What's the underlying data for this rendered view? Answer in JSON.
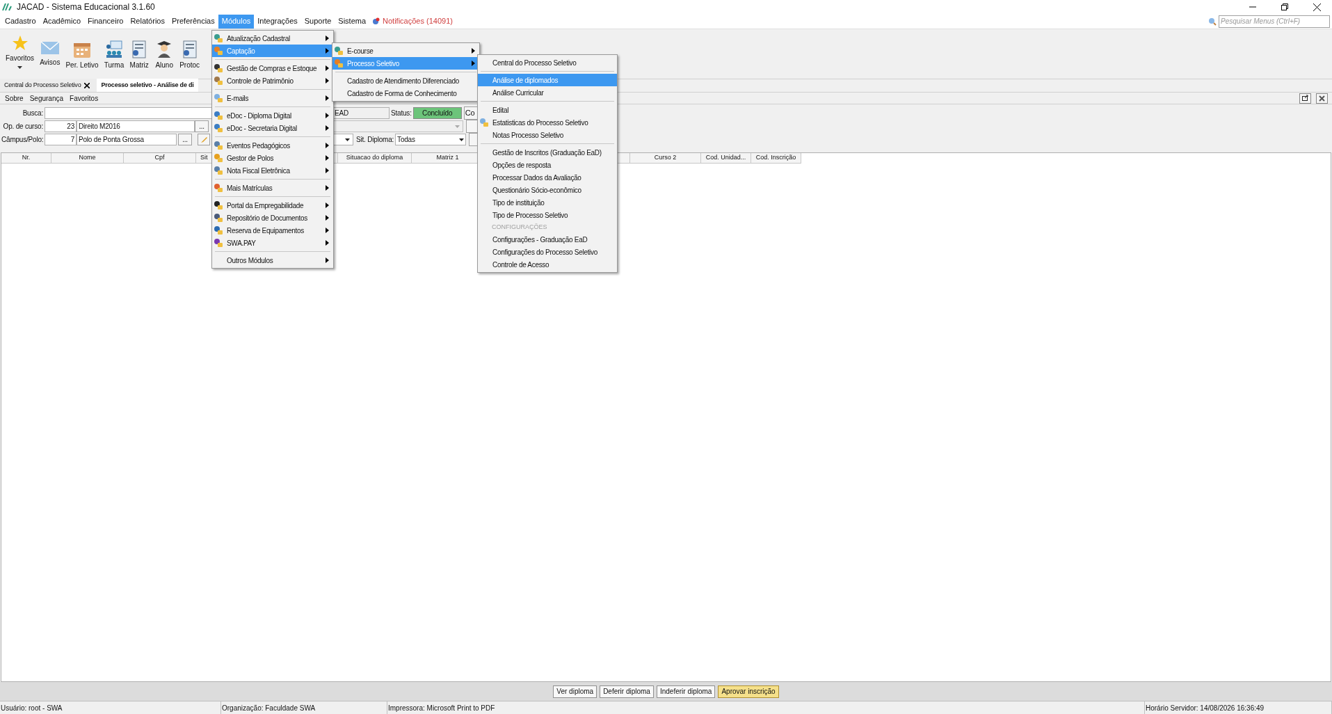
{
  "window": {
    "title": "JACAD - Sistema Educacional 3.1.60"
  },
  "menubar": [
    {
      "label": "Cadastro",
      "selected": false
    },
    {
      "label": "Acadêmico",
      "selected": false
    },
    {
      "label": "Financeiro",
      "selected": false
    },
    {
      "label": "Relatórios",
      "selected": false
    },
    {
      "label": "Preferências",
      "selected": false
    },
    {
      "label": "Módulos",
      "selected": true
    },
    {
      "label": "Integrações",
      "selected": false
    },
    {
      "label": "Suporte",
      "selected": false
    },
    {
      "label": "Sistema",
      "selected": false
    }
  ],
  "notifications": "Notificações (14091)",
  "menu_search": {
    "placeholder": "Pesquisar Menus (Ctrl+F)"
  },
  "toolbar": [
    {
      "label": "Favoritos",
      "kind": "star"
    },
    {
      "label": "Avisos",
      "kind": "mail"
    },
    {
      "label": "Per. Letivo",
      "kind": "calendar"
    },
    {
      "label": "Turma",
      "kind": "class"
    },
    {
      "label": "Matriz",
      "kind": "doc"
    },
    {
      "label": "Aluno",
      "kind": "student"
    },
    {
      "label": "Protoc",
      "kind": "doc"
    }
  ],
  "tabs": [
    {
      "label": "Central do Processo Seletivo",
      "selected": false,
      "closable": true
    },
    {
      "label": "Processo seletivo - Análise de di",
      "selected": true,
      "closable": false
    }
  ],
  "submenu": [
    "Sobre",
    "Segurança",
    "Favoritos"
  ],
  "form": {
    "busca_label": "Busca:",
    "course_label": "Op. de curso:",
    "course_code": "23",
    "course_name": "Direito M2016",
    "campus_label": "Câmpus/Polo:",
    "campus_code": "7",
    "campus_name": "Polo de Ponta Grossa",
    "ellipsis_1": "...",
    "ellipsis_2": "...",
    "ead_value": "EAD",
    "status_label": "Status:",
    "status_value": "Concluído",
    "co_button": "Co",
    "diploma_label": "Sit. Diploma:",
    "diploma_value": "Todas"
  },
  "table": {
    "columns": [
      "Nr.",
      "Nome",
      "Cpf",
      "Sit",
      "",
      "Situacao do diploma",
      "Matriz 1",
      "",
      "Curso 2",
      "Cod. Unidad...",
      "Cod. Inscrição"
    ]
  },
  "actions": [
    {
      "label": "Ver diploma",
      "highlighted": false
    },
    {
      "label": "Deferir diploma",
      "highlighted": false
    },
    {
      "label": "Indeferir diploma",
      "highlighted": false
    },
    {
      "label": "Aprovar inscrição",
      "highlighted": true
    }
  ],
  "status_bar": [
    "Usuário: root - SWA",
    "Organização: Faculdade SWA",
    "Impressora: Microsoft Print to PDF",
    "Horário Servidor: 14/08/2026 16:36:49"
  ],
  "modules_menu": [
    {
      "kind": "item",
      "label": "Atualização Cadastral",
      "has_icon": true,
      "selected": false
    },
    {
      "kind": "item",
      "label": "Captação",
      "has_icon": true,
      "selected": true
    },
    {
      "kind": "separator"
    },
    {
      "kind": "item",
      "label": "Gestão de Compras e Estoque",
      "has_icon": true,
      "selected": false
    },
    {
      "kind": "item",
      "label": "Controle de Patrimônio",
      "has_icon": true,
      "selected": false
    },
    {
      "kind": "separator"
    },
    {
      "kind": "item",
      "label": "E-mails",
      "has_icon": true,
      "selected": false
    },
    {
      "kind": "separator"
    },
    {
      "kind": "item",
      "label": "eDoc - Diploma Digital",
      "has_icon": true,
      "selected": false
    },
    {
      "kind": "item",
      "label": "eDoc - Secretaria Digital",
      "has_icon": true,
      "selected": false
    },
    {
      "kind": "separator"
    },
    {
      "kind": "item",
      "label": "Eventos Pedagógicos",
      "has_icon": true,
      "selected": false
    },
    {
      "kind": "item",
      "label": "Gestor de Polos",
      "has_icon": true,
      "selected": false
    },
    {
      "kind": "item",
      "label": "Nota Fiscal Eletrônica",
      "has_icon": true,
      "selected": false
    },
    {
      "kind": "separator"
    },
    {
      "kind": "item",
      "label": "Mais Matrículas",
      "has_icon": true,
      "selected": false
    },
    {
      "kind": "separator"
    },
    {
      "kind": "item",
      "label": "Portal da Empregabilidade",
      "has_icon": true,
      "selected": false
    },
    {
      "kind": "item",
      "label": "Repositório de Documentos",
      "has_icon": true,
      "selected": false
    },
    {
      "kind": "item",
      "label": "Reserva de Equipamentos",
      "has_icon": true,
      "selected": false
    },
    {
      "kind": "item",
      "label": "SWA.PAY",
      "has_icon": true,
      "selected": false
    },
    {
      "kind": "separator"
    },
    {
      "kind": "item",
      "label": "Outros Módulos",
      "has_icon": false,
      "selected": false
    }
  ],
  "captacao_menu": [
    {
      "kind": "submenu",
      "label": "E-course",
      "has_icon": true,
      "selected": false
    },
    {
      "kind": "submenu",
      "label": "Processo Seletivo",
      "has_icon": true,
      "selected": true
    },
    {
      "kind": "separator"
    },
    {
      "kind": "item",
      "label": "Cadastro de Atendimento Diferenciado",
      "has_icon": false,
      "selected": false
    },
    {
      "kind": "item",
      "label": "Cadastro de Forma de Conhecimento",
      "has_icon": false,
      "selected": false
    }
  ],
  "processo_menu": [
    {
      "kind": "item",
      "label": "Central do Processo Seletivo",
      "has_icon": false,
      "selected": false
    },
    {
      "kind": "separator"
    },
    {
      "kind": "item",
      "label": "Análise de diplomados",
      "has_icon": false,
      "selected": true
    },
    {
      "kind": "item",
      "label": "Análise Curricular",
      "has_icon": false,
      "selected": false
    },
    {
      "kind": "separator"
    },
    {
      "kind": "item",
      "label": "Edital",
      "has_icon": false,
      "selected": false
    },
    {
      "kind": "item",
      "label": "Estatisticas do Processo Seletivo",
      "has_icon": true,
      "selected": false
    },
    {
      "kind": "item",
      "label": "Notas Processo Seletivo",
      "has_icon": false,
      "selected": false
    },
    {
      "kind": "separator"
    },
    {
      "kind": "item",
      "label": "Gestão de Inscritos (Graduação EaD)",
      "has_icon": false,
      "selected": false
    },
    {
      "kind": "item",
      "label": "Opções de resposta",
      "has_icon": false,
      "selected": false
    },
    {
      "kind": "item",
      "label": "Processar Dados da Avaliação",
      "has_icon": false,
      "selected": false
    },
    {
      "kind": "item",
      "label": "Questionário Sócio-econômico",
      "has_icon": false,
      "selected": false
    },
    {
      "kind": "item",
      "label": "Tipo de instituição",
      "has_icon": false,
      "selected": false
    },
    {
      "kind": "item",
      "label": "Tipo de Processo Seletivo",
      "has_icon": false,
      "selected": false
    },
    {
      "kind": "header",
      "label": "CONFIGURAÇÕES"
    },
    {
      "kind": "item",
      "label": "Configurações - Graduação EaD",
      "has_icon": false,
      "selected": false
    },
    {
      "kind": "item",
      "label": "Configurações do Processo Seletivo",
      "has_icon": false,
      "selected": false
    },
    {
      "kind": "item",
      "label": "Controle de Acesso",
      "has_icon": false,
      "selected": false
    }
  ]
}
